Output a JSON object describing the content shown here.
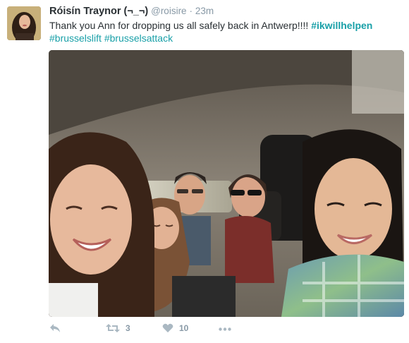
{
  "tweet": {
    "author_name": "Róisín Traynor (¬_¬)",
    "handle": "@roisire",
    "separator": "·",
    "time": "23m",
    "text_main": "Thank you Ann for dropping us all safely back in Antwerp!!!! ",
    "hashtags": [
      "#ikwillhelpen",
      "#brusselslift",
      "#brusselsattack"
    ],
    "photo_description_icon": "selfie-photo",
    "retweet_count": "3",
    "like_count": "10"
  },
  "icons": {
    "reply": "reply-icon",
    "retweet": "retweet-icon",
    "like": "heart-icon",
    "more": "more-icon"
  },
  "colors": {
    "hashtag": "#19a0a8",
    "muted": "#8899a6",
    "icon": "#aab8c2",
    "text": "#292f33"
  }
}
